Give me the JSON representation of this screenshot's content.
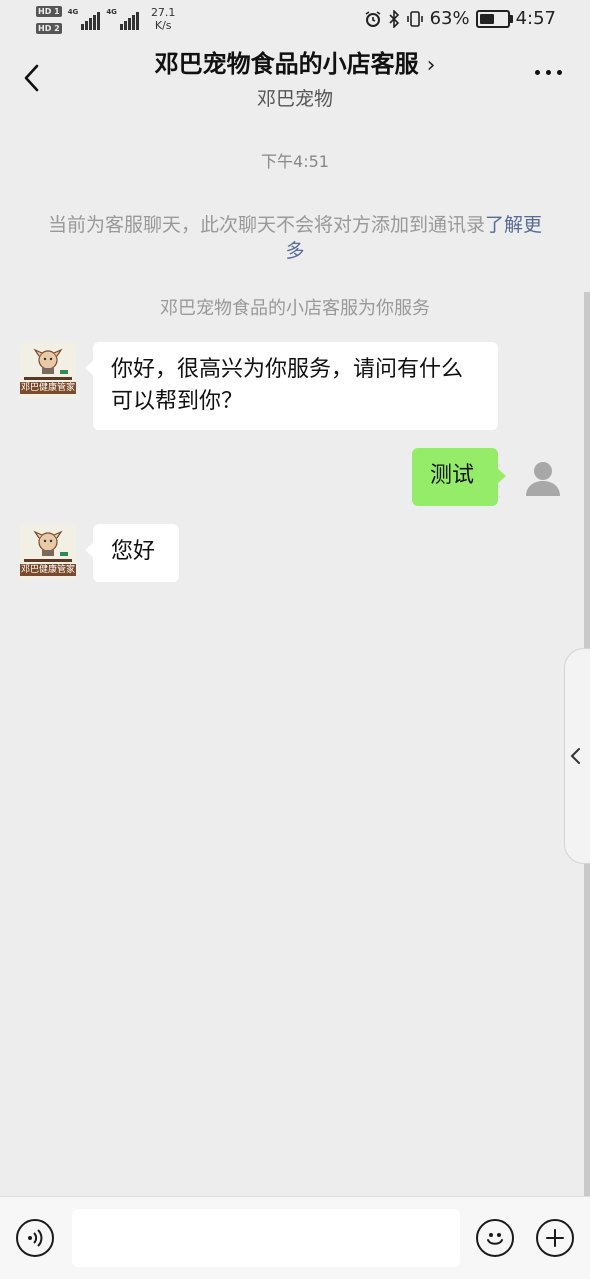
{
  "status_bar": {
    "hd_labels": [
      "HD 1",
      "HD 2"
    ],
    "network": [
      "4G",
      "4G"
    ],
    "speed_value": "27.1",
    "speed_unit": "K/s",
    "battery": "63%",
    "battery_level": 0.63,
    "time": "4:57"
  },
  "header": {
    "title": "邓巴宠物食品的小店客服",
    "subtitle": "邓巴宠物"
  },
  "chat": {
    "timestamp": "下午4:51",
    "notice_text": "当前为客服聊天，此次聊天不会将对方添加到通讯录",
    "notice_link": "了解更多",
    "service_text": "邓巴宠物食品的小店客服为你服务",
    "shop_avatar_text": "邓巴健康管家",
    "messages": [
      {
        "side": "left",
        "text": "你好，很高兴为你服务，请问有什么可以帮到你？"
      },
      {
        "side": "right",
        "text": "测试"
      },
      {
        "side": "left",
        "text": "您好"
      }
    ]
  },
  "colors": {
    "background": "#ededed",
    "sent_bubble": "#95ec69",
    "received_bubble": "#ffffff",
    "link": "#576b95"
  },
  "icons": [
    "back-arrow-icon",
    "chevron-right-icon",
    "more-dots-icon",
    "voice-icon",
    "emoji-icon",
    "plus-icon",
    "alarm-icon",
    "bluetooth-icon",
    "vibrate-icon"
  ]
}
